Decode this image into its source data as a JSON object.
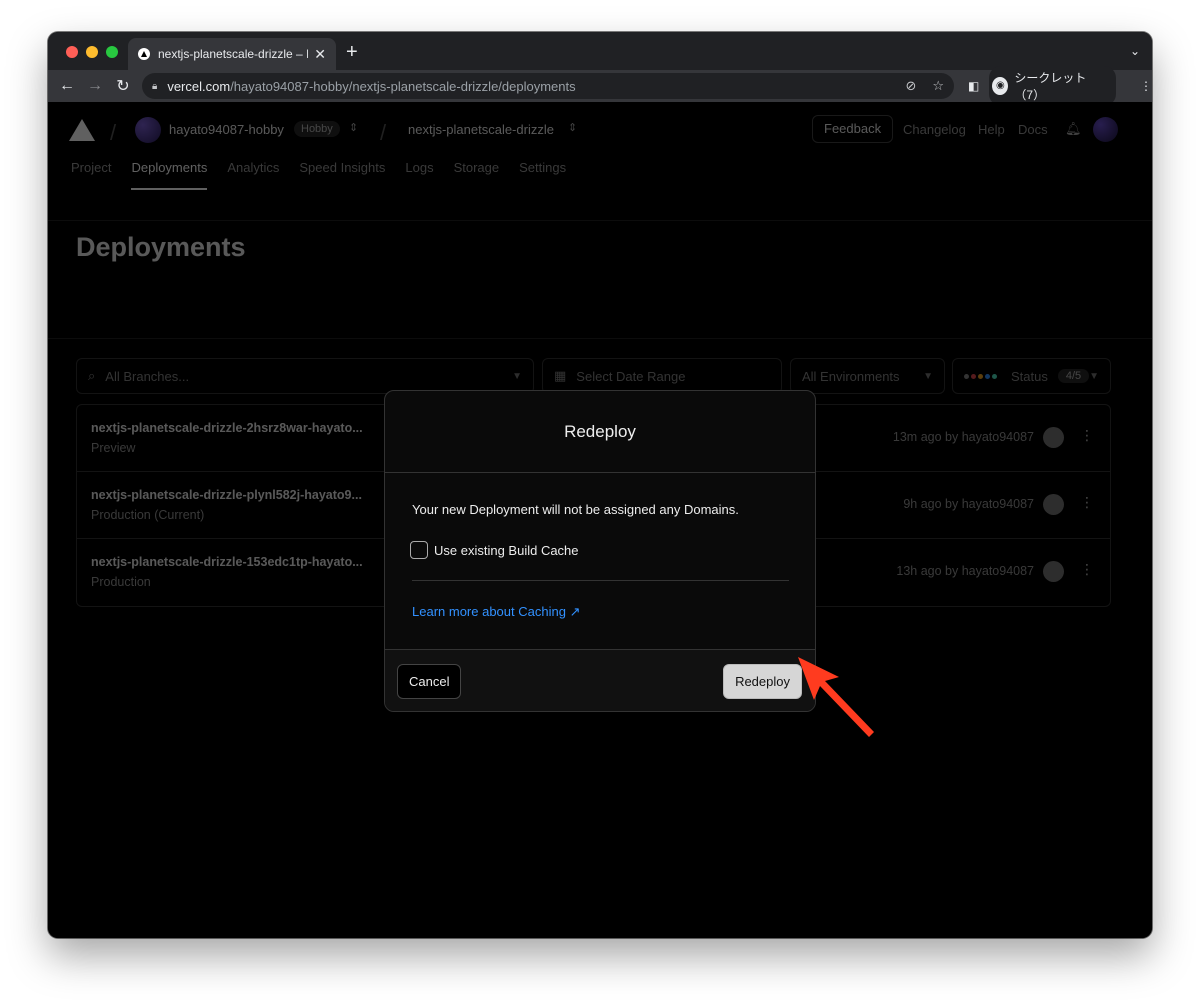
{
  "browser": {
    "tab_title": "nextjs-planetscale-drizzle – De",
    "url_host": "vercel.com",
    "url_path": "/hayato94087-hobby/nextjs-planetscale-drizzle/deployments",
    "incognito_label": "シークレット（7）",
    "colors": {
      "close": "#ff5f57",
      "minimize": "#febc2e",
      "maximize": "#28c840"
    }
  },
  "header": {
    "team_name": "hayato94087-hobby",
    "plan_badge": "Hobby",
    "project_name": "nextjs-planetscale-drizzle",
    "feedback_label": "Feedback",
    "changelog_label": "Changelog",
    "help_label": "Help",
    "docs_label": "Docs"
  },
  "nav": {
    "tabs": [
      "Project",
      "Deployments",
      "Analytics",
      "Speed Insights",
      "Logs",
      "Storage",
      "Settings"
    ],
    "active": "Deployments"
  },
  "page_title": "Deployments",
  "filters": {
    "branches_placeholder": "All Branches...",
    "date_range": "Select Date Range",
    "environments": "All Environments",
    "status_label": "Status",
    "status_count": "4/5"
  },
  "deployments": [
    {
      "name": "nextjs-planetscale-drizzle-2hsrz8war-hayato...",
      "env": "Preview",
      "meta": "13m ago by hayato94087"
    },
    {
      "name": "nextjs-planetscale-drizzle-plynl582j-hayato9...",
      "env": "Production (Current)",
      "meta": "9h ago by hayato94087"
    },
    {
      "name": "nextjs-planetscale-drizzle-153edc1tp-hayato...",
      "env": "Production",
      "meta": "13h ago by hayato94087"
    }
  ],
  "modal": {
    "title": "Redeploy",
    "message": "Your new Deployment will not be assigned any Domains.",
    "checkbox_label": "Use existing Build Cache",
    "checkbox_checked": false,
    "learn_more": "Learn more about Caching",
    "cancel_label": "Cancel",
    "confirm_label": "Redeploy"
  },
  "annotation_color": "#ff3b1f"
}
